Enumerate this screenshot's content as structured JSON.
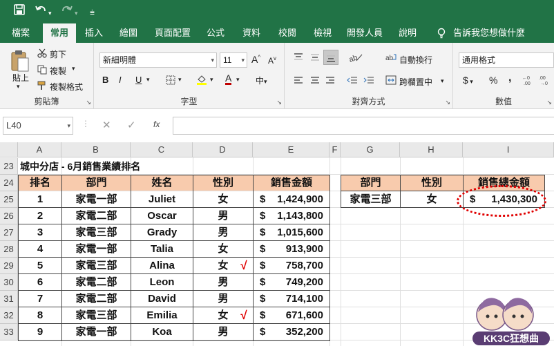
{
  "qat": {
    "save_icon": "save-icon",
    "undo_icon": "undo-icon",
    "redo_icon": "redo-icon",
    "customize_icon": "customize-icon"
  },
  "tabs": [
    "檔案",
    "常用",
    "插入",
    "繪圖",
    "頁面配置",
    "公式",
    "資料",
    "校閱",
    "檢視",
    "開發人員",
    "說明"
  ],
  "tell_me": "告訴我您想做什麼",
  "ribbon": {
    "clipboard": {
      "paste": "貼上",
      "cut": "剪下",
      "copy": "複製",
      "format_painter": "複製格式",
      "label": "剪貼簿"
    },
    "font": {
      "name": "新細明體",
      "size": "11",
      "label": "字型",
      "bold": "B",
      "italic": "I",
      "underline": "U",
      "grow": "A",
      "shrink": "A",
      "font_color_letter": "A",
      "phonetic": "中",
      "accent": "#c00000"
    },
    "alignment": {
      "wrap": "自動換行",
      "merge": "跨欄置中",
      "label": "對齊方式"
    },
    "number": {
      "format": "通用格式",
      "currency": "$",
      "percent": "%",
      "comma": ",",
      "label": "數值"
    }
  },
  "formula_bar": {
    "name_box": "L40",
    "fx": "fx",
    "value": ""
  },
  "columns": [
    "A",
    "B",
    "C",
    "D",
    "E",
    "F",
    "G",
    "H",
    "I"
  ],
  "rows": [
    "23",
    "24",
    "25",
    "26",
    "27",
    "28",
    "29",
    "30",
    "31",
    "32",
    "33"
  ],
  "sheet": {
    "title": "城中分店 - 6月銷售業績排名",
    "headers": [
      "排名",
      "部門",
      "姓名",
      "性別",
      "銷售金額"
    ],
    "data": [
      {
        "rank": "1",
        "dept": "家電一部",
        "name": "Juliet",
        "gender": "女",
        "amount": "1,424,900",
        "check": ""
      },
      {
        "rank": "2",
        "dept": "家電二部",
        "name": "Oscar",
        "gender": "男",
        "amount": "1,143,800",
        "check": ""
      },
      {
        "rank": "3",
        "dept": "家電三部",
        "name": "Grady",
        "gender": "男",
        "amount": "1,015,600",
        "check": ""
      },
      {
        "rank": "4",
        "dept": "家電一部",
        "name": "Talia",
        "gender": "女",
        "amount": "913,900",
        "check": ""
      },
      {
        "rank": "5",
        "dept": "家電三部",
        "name": "Alina",
        "gender": "女",
        "amount": "758,700",
        "check": "√"
      },
      {
        "rank": "6",
        "dept": "家電二部",
        "name": "Leon",
        "gender": "男",
        "amount": "749,200",
        "check": ""
      },
      {
        "rank": "7",
        "dept": "家電二部",
        "name": "David",
        "gender": "男",
        "amount": "714,100",
        "check": ""
      },
      {
        "rank": "8",
        "dept": "家電三部",
        "name": "Emilia",
        "gender": "女",
        "amount": "671,600",
        "check": "√"
      },
      {
        "rank": "9",
        "dept": "家電一部",
        "name": "Koa",
        "gender": "男",
        "amount": "352,200",
        "check": ""
      }
    ],
    "currency": "$",
    "summary_headers": [
      "部門",
      "性別",
      "銷售總金額"
    ],
    "summary_row": {
      "dept": "家電三部",
      "gender": "女",
      "amount": "1,430,300"
    }
  },
  "watermark": "KK3C狂想曲",
  "colors": {
    "excel_green": "#217346",
    "header_fill": "#f8cbad",
    "highlight_red": "#e00000"
  }
}
